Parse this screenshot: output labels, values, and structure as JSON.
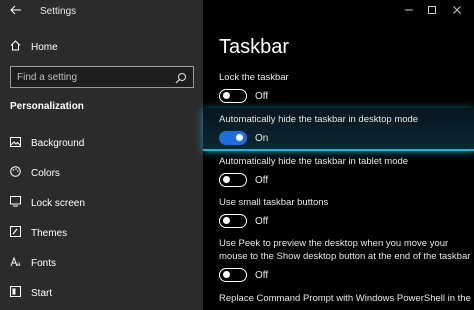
{
  "window": {
    "title": "Settings"
  },
  "sidebar": {
    "home_label": "Home",
    "search_placeholder": "Find a setting",
    "section_title": "Personalization",
    "items": [
      {
        "label": "Background",
        "icon": "image-icon"
      },
      {
        "label": "Colors",
        "icon": "palette-icon"
      },
      {
        "label": "Lock screen",
        "icon": "lock-screen-icon"
      },
      {
        "label": "Themes",
        "icon": "brush-icon"
      },
      {
        "label": "Fonts",
        "icon": "font-icon"
      },
      {
        "label": "Start",
        "icon": "start-icon"
      }
    ]
  },
  "main": {
    "title": "Taskbar",
    "settings": [
      {
        "label": "Lock the taskbar",
        "state": "Off"
      },
      {
        "label": "Automatically hide the taskbar in desktop mode",
        "state": "On"
      },
      {
        "label": "Automatically hide the taskbar in tablet mode",
        "state": "Off"
      },
      {
        "label": "Use small taskbar buttons",
        "state": "Off"
      },
      {
        "label_line1": "Use Peek to preview the desktop when you move your",
        "label_line2": "mouse to the Show desktop button at the end of the taskbar",
        "state": "Off"
      },
      {
        "label_line1": "Replace Command Prompt with Windows PowerShell in the"
      }
    ]
  },
  "colors": {
    "accent": "#1e6fd9",
    "highlight_glow": "#19b7d6",
    "sidebar_bg": "#2b2b2b",
    "main_bg": "#000000"
  }
}
